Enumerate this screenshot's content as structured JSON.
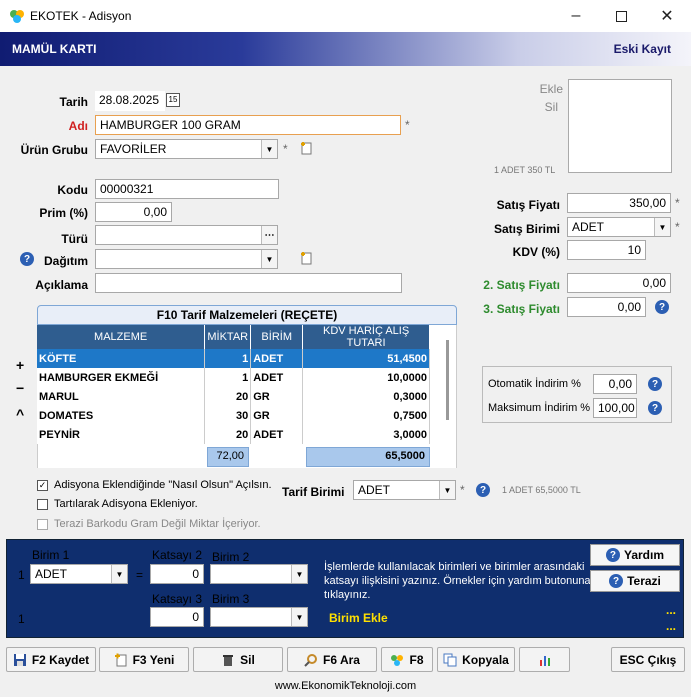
{
  "window": {
    "title": "EKOTEK - Adisyon"
  },
  "header": {
    "title": "MAMÜL KARTI",
    "right": "Eski Kayıt"
  },
  "form": {
    "tarih_label": "Tarih",
    "tarih_value": "28.08.2025",
    "adi_label": "Adı",
    "adi_value": "HAMBURGER 100 GRAM",
    "urun_grubu_label": "Ürün Grubu",
    "urun_grubu_value": "FAVORİLER",
    "kodu_label": "Kodu",
    "kodu_value": "00000321",
    "prim_label": "Prim (%)",
    "prim_value": "0,00",
    "turu_label": "Türü",
    "turu_value": "",
    "dagitim_label": "Dağıtım",
    "dagitim_value": "",
    "aciklama_label": "Açıklama",
    "aciklama_value": ""
  },
  "image_panel": {
    "ekle": "Ekle",
    "sil": "Sil",
    "caption": "1 ADET 350 TL"
  },
  "pricing": {
    "satis_fiyati_label": "Satış Fiyatı",
    "satis_fiyati_value": "350,00",
    "satis_birimi_label": "Satış Birimi",
    "satis_birimi_value": "ADET",
    "kdv_label": "KDV  (%)",
    "kdv_value": "10",
    "satis2_label": "2. Satış Fiyatı",
    "satis2_value": "0,00",
    "satis3_label": "3. Satış Fiyatı",
    "satis3_value": "0,00"
  },
  "discount": {
    "oto_label": "Otomatik İndirim %",
    "oto_value": "0,00",
    "max_label": "Maksimum İndirim %",
    "max_value": "100,00"
  },
  "recipe": {
    "title": "F10 Tarif Malzemeleri (REÇETE)",
    "columns": [
      "MALZEME",
      "MİKTAR",
      "BİRİM",
      "KDV HARİÇ ALIŞ TUTARI"
    ],
    "rows": [
      [
        "KÖFTE",
        "1",
        "ADET",
        "51,4500"
      ],
      [
        "HAMBURGER EKMEĞİ",
        "1",
        "ADET",
        "10,0000"
      ],
      [
        "MARUL",
        "20",
        "GR",
        "0,3000"
      ],
      [
        "DOMATES",
        "30",
        "GR",
        "0,7500"
      ],
      [
        "PEYNİR",
        "20",
        "ADET",
        "3,0000"
      ]
    ],
    "total_miktar": "72,00",
    "total_tutar": "65,5000",
    "side_plus": "+",
    "side_minus": "−",
    "side_up": "^"
  },
  "options": {
    "opt1": "Adisyona Eklendiğinde \"Nasıl Olsun\" Açılsın.",
    "opt1_checked": true,
    "opt2": "Tartılarak Adisyona Ekleniyor.",
    "opt3": "Terazi Barkodu Gram Değil Miktar İçeriyor."
  },
  "tarif": {
    "label": "Tarif Birimi",
    "value": "ADET",
    "info": "1 ADET 65,5000 TL"
  },
  "units": {
    "birim1_label": "Birim 1",
    "row1_num": "1",
    "birim1_value": "ADET",
    "eq": "=",
    "katsayi2_label": "Katsayı 2",
    "katsayi2_value": "0",
    "birim2_label": "Birim 2",
    "birim2_value": "",
    "row2_num": "1",
    "katsayi3_label": "Katsayı 3",
    "katsayi3_value": "0",
    "birim3_label": "Birim 3",
    "birim3_value": "",
    "info": "İşlemlerde kullanılacak birimleri ve birimler arasındaki katsayı ilişkisini yazınız. Örnekler için yardım butonuna tıklayınız.",
    "birim_ekle": "Birim Ekle",
    "yardim": "Yardım",
    "terazi": "Terazi",
    "dots": "..."
  },
  "buttons": {
    "kaydet": "F2 Kaydet",
    "yeni": "F3 Yeni",
    "sil": "Sil",
    "ara": "F6 Ara",
    "f8": "F8",
    "kopyala": "Kopyala",
    "cikis": "ESC Çıkış"
  },
  "footer": "www.EkonomikTeknoloji.com",
  "colors": {
    "header_dark": "#101c72",
    "selected_row": "#1e78c8",
    "units_panel": "#0f2e6e",
    "green_label": "#2e8b2e"
  }
}
